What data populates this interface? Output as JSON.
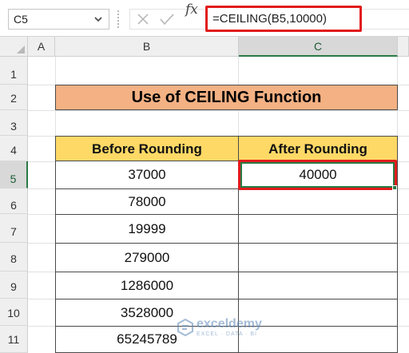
{
  "name_box": {
    "value": "C5"
  },
  "formula_bar": {
    "fx_label": "fx",
    "formula": "=CEILING(B5,10000)"
  },
  "columns": [
    "A",
    "B",
    "C"
  ],
  "rows": [
    "1",
    "2",
    "3",
    "4",
    "5",
    "6",
    "7",
    "8",
    "9",
    "10",
    "11"
  ],
  "title": "Use of CEILING Function",
  "table": {
    "headers": [
      "Before Rounding",
      "After Rounding"
    ],
    "rows": [
      {
        "before": "37000",
        "after": "40000"
      },
      {
        "before": "78000",
        "after": ""
      },
      {
        "before": "19999",
        "after": ""
      },
      {
        "before": "279000",
        "after": ""
      },
      {
        "before": "1286000",
        "after": ""
      },
      {
        "before": "3528000",
        "after": ""
      },
      {
        "before": "65245789",
        "after": ""
      }
    ]
  },
  "watermark": {
    "name": "exceldemy",
    "tagline": "EXCEL · DATA · BI"
  },
  "colors": {
    "title_fill": "#f4b183",
    "header_fill": "#ffd966",
    "highlight": "#e11c1c",
    "selection": "#2a7a45"
  }
}
